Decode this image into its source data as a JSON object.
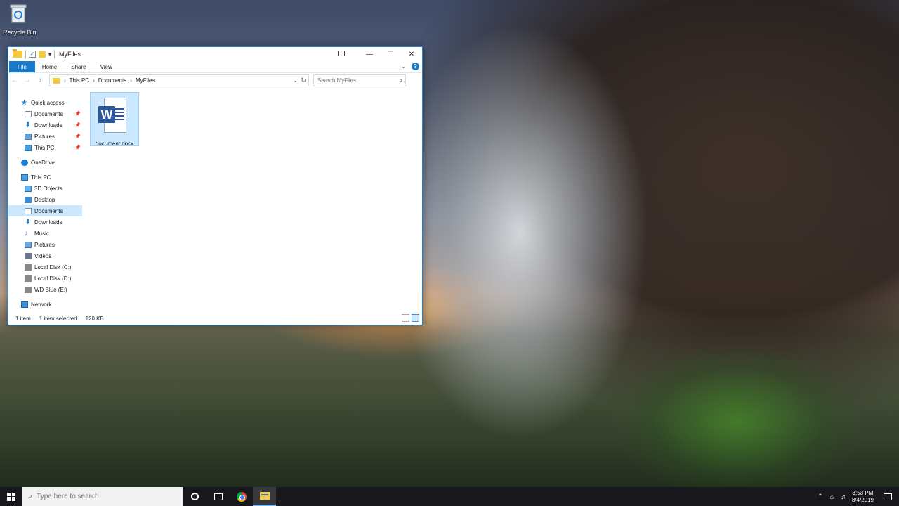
{
  "desktop": {
    "recycle_bin_label": "Recycle Bin"
  },
  "window": {
    "title": "MyFiles",
    "ribbon_tabs": [
      "File",
      "Home",
      "Share",
      "View"
    ],
    "address": {
      "crumbs": [
        "This PC",
        "Documents",
        "MyFiles"
      ]
    },
    "search_placeholder": "Search MyFiles",
    "nav": {
      "quick_access": "Quick access",
      "quick_items": [
        "Documents",
        "Downloads",
        "Pictures",
        "This PC"
      ],
      "onedrive": "OneDrive",
      "this_pc": "This PC",
      "pc_items": [
        "3D Objects",
        "Desktop",
        "Documents",
        "Downloads",
        "Music",
        "Pictures",
        "Videos",
        "Local Disk (C:)",
        "Local Disk (D:)",
        "WD Blue (E:)"
      ],
      "network": "Network"
    },
    "files": [
      {
        "name": "document.docx",
        "icon": "word-doc-icon",
        "selected": true
      }
    ],
    "status": {
      "count": "1 item",
      "selection": "1 item selected",
      "size": "120 KB"
    }
  },
  "taskbar": {
    "search_placeholder": "Type here to search",
    "time": "3:53 PM",
    "date": "8/4/2019"
  },
  "colors": {
    "accent": "#1979ca",
    "selection": "#cce8ff",
    "word_blue": "#2b579a"
  }
}
